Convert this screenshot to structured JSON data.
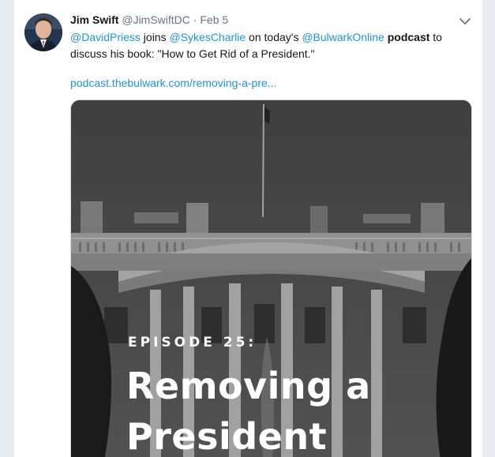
{
  "tweet": {
    "author_name": "Jim Swift",
    "author_handle": "@JimSwiftDC",
    "separator": "·",
    "date": "Feb 5",
    "text_parts": {
      "m1": "@DavidPriess",
      "t1": " joins ",
      "m2": "@SykesCharlie",
      "t2": " on today's ",
      "m3": "@BulwarkOnline",
      "t3": " ",
      "b1": "podcast",
      "t4": " to discuss his book: \"How to Get Rid of a President.\""
    },
    "link": "podcast.thebulwark.com/removing-a-pre..."
  },
  "media": {
    "episode_label": "EPISODE 25:",
    "title": "Removing a President"
  },
  "icons": {
    "caret": "chevron-down-icon",
    "avatar": "avatar"
  },
  "colors": {
    "link": "#1b95e0",
    "text": "#14171a",
    "muted": "#657786",
    "background": "#e6ecf0"
  }
}
